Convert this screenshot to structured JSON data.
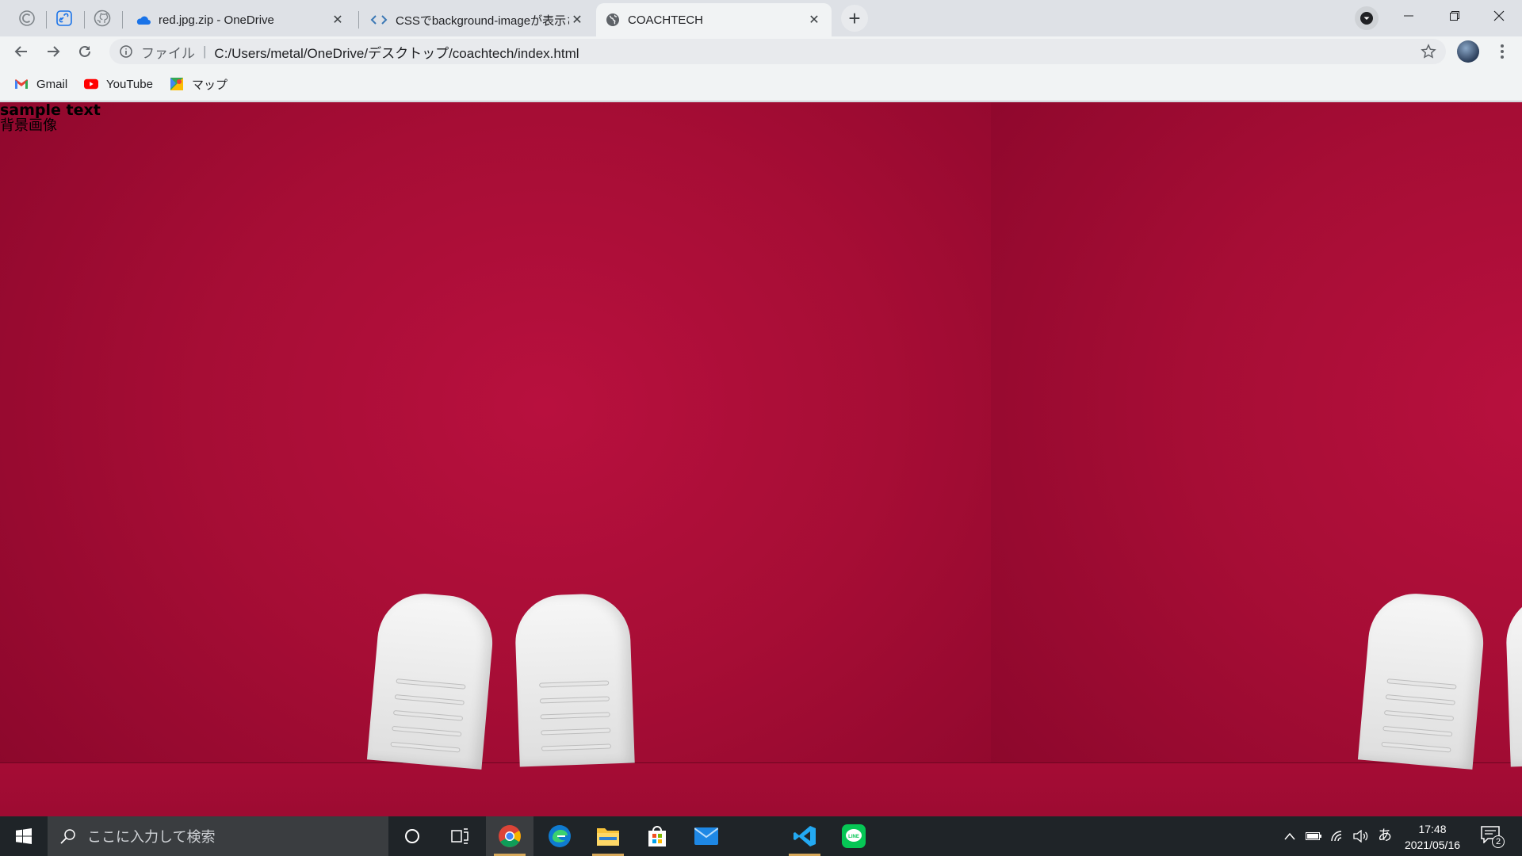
{
  "browser": {
    "tabs": [
      {
        "title": "red.jpg.zip - OneDrive",
        "icon": "onedrive-cloud-icon"
      },
      {
        "title": "CSSでbackground-imageが表示さ",
        "icon": "code-brackets-icon"
      },
      {
        "title": "COACHTECH",
        "icon": "globe-icon",
        "active": true
      }
    ],
    "pinned_tabs": [
      "circular-c-icon",
      "link-icon",
      "github-icon"
    ],
    "address": {
      "scheme_label": "ファイル",
      "divider": "|",
      "url": "C:/Users/metal/OneDrive/デスクトップ/coachtech/index.html"
    },
    "bookmarks": [
      {
        "label": "Gmail",
        "icon": "gmail-icon"
      },
      {
        "label": "YouTube",
        "icon": "youtube-icon"
      },
      {
        "label": "マップ",
        "icon": "maps-icon"
      }
    ]
  },
  "page": {
    "sample_text": "sample text",
    "background_caption": "背景画像",
    "background_image": "red carpet with white sneakers, tiled horizontally",
    "colors": {
      "carpet": "#a60d35",
      "shoe": "#f2f2f2"
    }
  },
  "taskbar": {
    "search_placeholder": "ここに入力して検索",
    "apps": [
      "cortana-icon",
      "task-view-icon",
      "chrome-icon",
      "edge-icon",
      "file-explorer-icon",
      "store-icon",
      "mail-icon",
      "vscode-icon",
      "line-icon"
    ],
    "ime": "あ",
    "time": "17:48",
    "date": "2021/05/16",
    "notification_count": "2"
  }
}
